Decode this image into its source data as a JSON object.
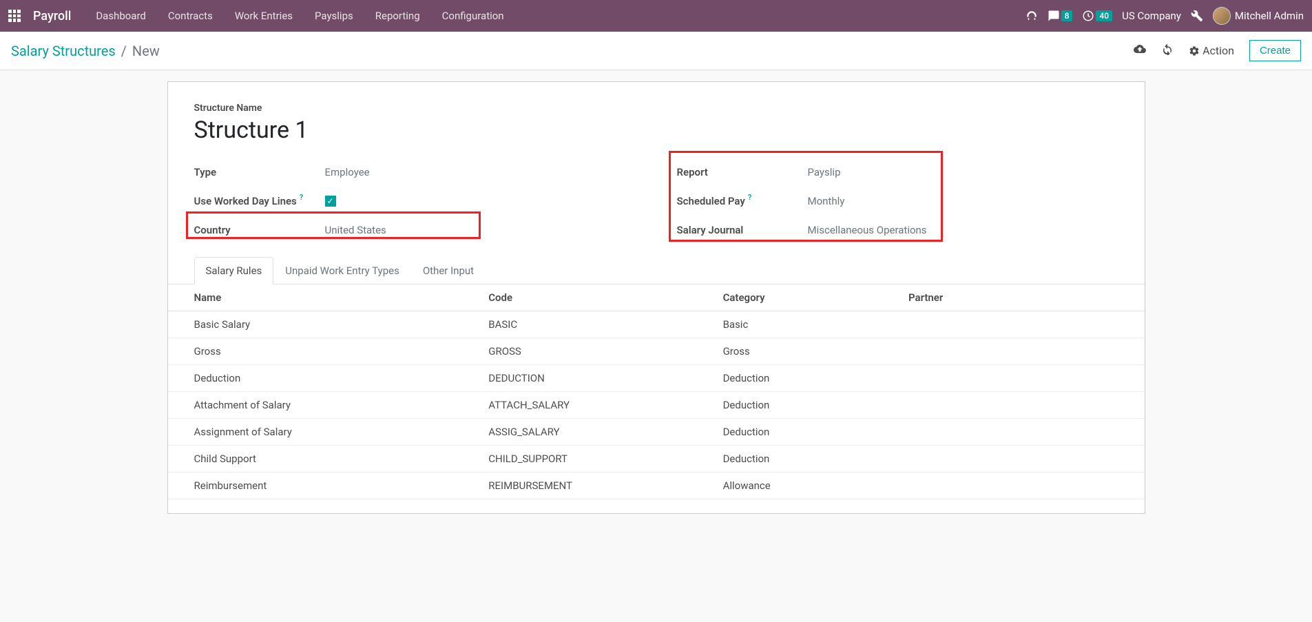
{
  "nav": {
    "brand": "Payroll",
    "items": [
      "Dashboard",
      "Contracts",
      "Work Entries",
      "Payslips",
      "Reporting",
      "Configuration"
    ],
    "msg_badge": "8",
    "timer_badge": "40",
    "company": "US Company",
    "username": "Mitchell Admin"
  },
  "control": {
    "breadcrumb_parent": "Salary Structures",
    "breadcrumb_current": "New",
    "action_label": "Action",
    "create_label": "Create"
  },
  "form": {
    "name_label": "Structure Name",
    "name_value": "Structure 1",
    "left": {
      "type_label": "Type",
      "type_value": "Employee",
      "worked_label": "Use Worked Day Lines",
      "country_label": "Country",
      "country_value": "United States"
    },
    "right": {
      "report_label": "Report",
      "report_value": "Payslip",
      "sched_label": "Scheduled Pay",
      "sched_value": "Monthly",
      "journal_label": "Salary Journal",
      "journal_value": "Miscellaneous Operations"
    }
  },
  "tabs": [
    "Salary Rules",
    "Unpaid Work Entry Types",
    "Other Input"
  ],
  "table": {
    "headers": [
      "Name",
      "Code",
      "Category",
      "Partner"
    ],
    "rows": [
      {
        "name": "Basic Salary",
        "code": "BASIC",
        "category": "Basic",
        "partner": ""
      },
      {
        "name": "Gross",
        "code": "GROSS",
        "category": "Gross",
        "partner": ""
      },
      {
        "name": "Deduction",
        "code": "DEDUCTION",
        "category": "Deduction",
        "partner": ""
      },
      {
        "name": "Attachment of Salary",
        "code": "ATTACH_SALARY",
        "category": "Deduction",
        "partner": ""
      },
      {
        "name": "Assignment of Salary",
        "code": "ASSIG_SALARY",
        "category": "Deduction",
        "partner": ""
      },
      {
        "name": "Child Support",
        "code": "CHILD_SUPPORT",
        "category": "Deduction",
        "partner": ""
      },
      {
        "name": "Reimbursement",
        "code": "REIMBURSEMENT",
        "category": "Allowance",
        "partner": ""
      }
    ]
  }
}
